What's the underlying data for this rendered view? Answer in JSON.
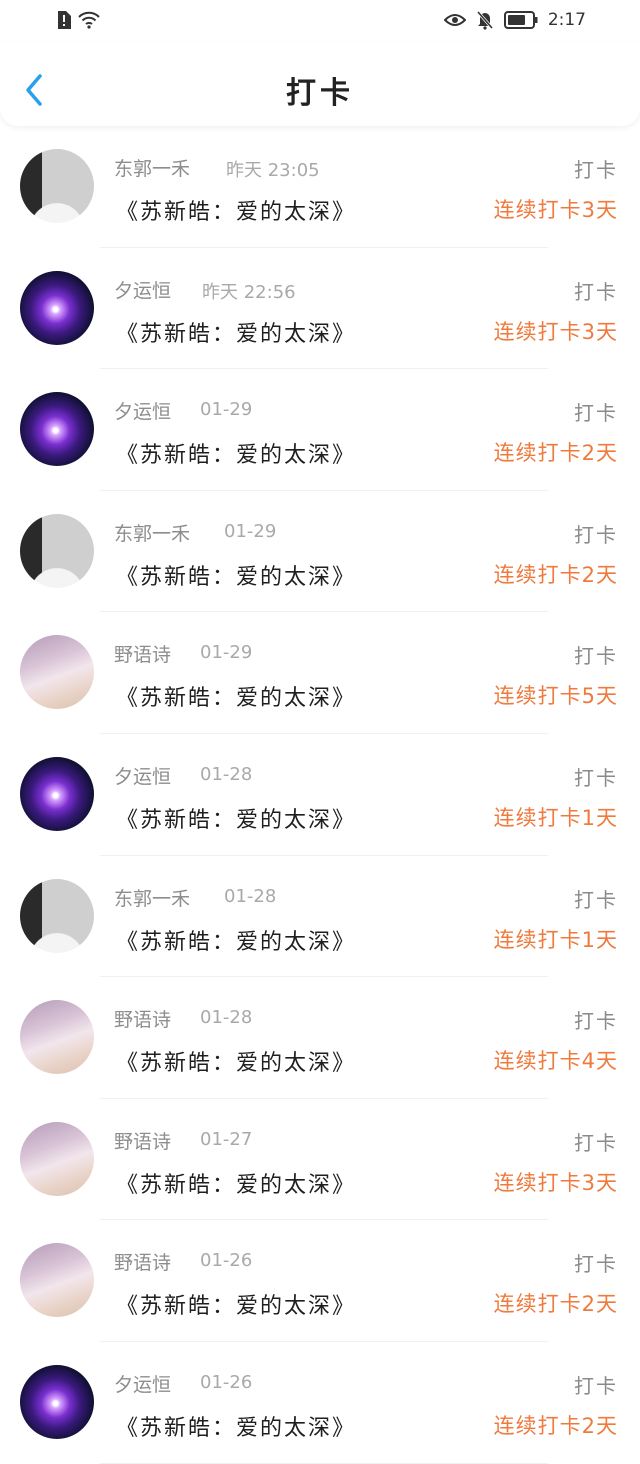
{
  "status": {
    "time": "2:17"
  },
  "header": {
    "title": "打卡"
  },
  "colors": {
    "accent": "#ef7a3d",
    "back": "#2aa0ec"
  },
  "rows": [
    {
      "name": "东郭一禾",
      "time": "昨天 23:05",
      "song": "《苏新皓：爱的太深》",
      "tag": "打卡",
      "streak": "连续打卡3天",
      "avatar": "person"
    },
    {
      "name": "夕运恒",
      "time": "昨天 22:56",
      "song": "《苏新皓：爱的太深》",
      "tag": "打卡",
      "streak": "连续打卡3天",
      "avatar": "galaxy"
    },
    {
      "name": "夕运恒",
      "time": "01-29",
      "song": "《苏新皓：爱的太深》",
      "tag": "打卡",
      "streak": "连续打卡2天",
      "avatar": "galaxy"
    },
    {
      "name": "东郭一禾",
      "time": "01-29",
      "song": "《苏新皓：爱的太深》",
      "tag": "打卡",
      "streak": "连续打卡2天",
      "avatar": "person"
    },
    {
      "name": "野语诗",
      "time": "01-29",
      "song": "《苏新皓：爱的太深》",
      "tag": "打卡",
      "streak": "连续打卡5天",
      "avatar": "beach"
    },
    {
      "name": "夕运恒",
      "time": "01-28",
      "song": "《苏新皓：爱的太深》",
      "tag": "打卡",
      "streak": "连续打卡1天",
      "avatar": "galaxy"
    },
    {
      "name": "东郭一禾",
      "time": "01-28",
      "song": "《苏新皓：爱的太深》",
      "tag": "打卡",
      "streak": "连续打卡1天",
      "avatar": "person"
    },
    {
      "name": "野语诗",
      "time": "01-28",
      "song": "《苏新皓：爱的太深》",
      "tag": "打卡",
      "streak": "连续打卡4天",
      "avatar": "beach"
    },
    {
      "name": "野语诗",
      "time": "01-27",
      "song": "《苏新皓：爱的太深》",
      "tag": "打卡",
      "streak": "连续打卡3天",
      "avatar": "beach"
    },
    {
      "name": "野语诗",
      "time": "01-26",
      "song": "《苏新皓：爱的太深》",
      "tag": "打卡",
      "streak": "连续打卡2天",
      "avatar": "beach"
    },
    {
      "name": "夕运恒",
      "time": "01-26",
      "song": "《苏新皓：爱的太深》",
      "tag": "打卡",
      "streak": "连续打卡2天",
      "avatar": "galaxy"
    }
  ]
}
